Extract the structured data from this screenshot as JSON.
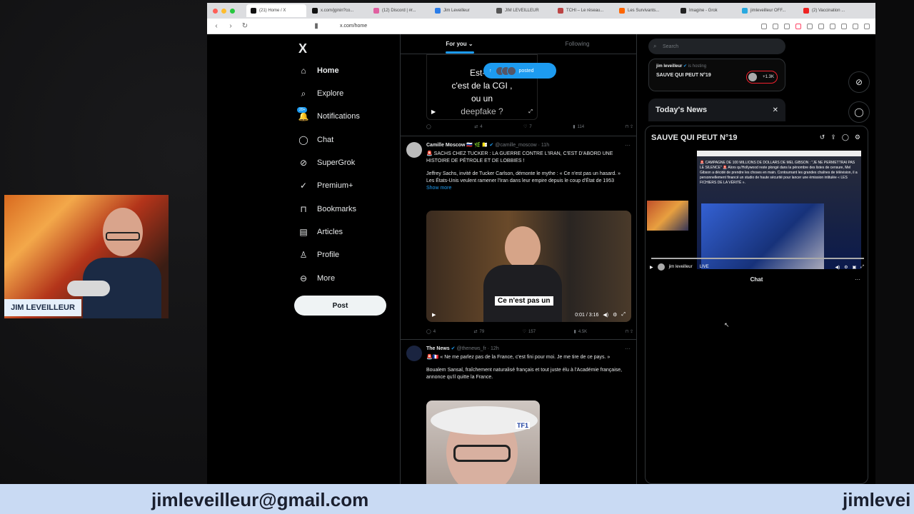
{
  "browser": {
    "tabs": [
      {
        "label": "(21) Home / X",
        "active": true,
        "color": "#111"
      },
      {
        "label": "x.com/jginin?co...",
        "active": false,
        "color": "#111"
      },
      {
        "label": "(12) Discord | #r...",
        "active": false,
        "color": "#e05fa0"
      },
      {
        "label": "Jim Leveilleur",
        "active": false,
        "color": "#2b7de9"
      },
      {
        "label": "JIM LEVEILLEUR",
        "active": false,
        "color": "#555"
      },
      {
        "label": "TCHI – Le réseau...",
        "active": false,
        "color": "#b44"
      },
      {
        "label": "Les Survivants...",
        "active": false,
        "color": "#f60"
      },
      {
        "label": "Imagine - Grok",
        "active": false,
        "color": "#222"
      },
      {
        "label": "jimleveilleur OFF...",
        "active": false,
        "color": "#29a9e0"
      },
      {
        "label": "(2) Vaccination ...",
        "active": false,
        "color": "#e22"
      }
    ],
    "url": "x.com/home"
  },
  "nav": {
    "logo": "X",
    "items": [
      {
        "label": "Home",
        "icon": "home-icon",
        "glyph": "⌂",
        "bold": true
      },
      {
        "label": "Explore",
        "icon": "search-icon",
        "glyph": "⌕"
      },
      {
        "label": "Notifications",
        "icon": "bell-icon",
        "glyph": "🔔",
        "badge": "20+"
      },
      {
        "label": "Chat",
        "icon": "chat-icon",
        "glyph": "◯"
      },
      {
        "label": "SuperGrok",
        "icon": "grok-icon",
        "glyph": "⊘"
      },
      {
        "label": "Premium+",
        "icon": "premium-icon",
        "glyph": "✓"
      },
      {
        "label": "Bookmarks",
        "icon": "bookmark-icon",
        "glyph": "⊓"
      },
      {
        "label": "Articles",
        "icon": "articles-icon",
        "glyph": "▤"
      },
      {
        "label": "Profile",
        "icon": "profile-icon",
        "glyph": "♙"
      },
      {
        "label": "More",
        "icon": "more-icon",
        "glyph": "⊖"
      }
    ],
    "post": "Post"
  },
  "feed": {
    "tabs": [
      "For you",
      "Following"
    ],
    "video_text": [
      "Est-ce",
      "c'est de la CGI ,",
      "ou un",
      "deepfake ?"
    ],
    "posted_pill": "posted",
    "tweet1_actions": {
      "replies": "",
      "reposts": "4",
      "likes": "7",
      "views": "114"
    },
    "tweet2": {
      "name": "Camille Moscow",
      "flags": "🇷🇺 🌿 🇻🇦",
      "handle": "@camille_moscow · 11h",
      "line1": "🚨 SACHS CHEZ TUCKER : LA GUERRE CONTRE L'IRAN, C'EST D'ABORD UNE HISTOIRE DE PÉTROLE ET DE LOBBIES !",
      "line2": "Jeffrey Sachs, invité de Tucker Carlson, démonte le mythe : « Ce n'est pas un hasard. » Les États-Unis veulent ramener l'Iran dans leur empire depuis le coup d'État de 1953",
      "showmore": "Show more",
      "subtitle": "Ce n'est pas un",
      "time": "0:01 / 3:16",
      "actions": {
        "replies": "4",
        "reposts": "79",
        "likes": "157",
        "views": "4.5K"
      }
    },
    "tweet3": {
      "name": "The News",
      "handle": "@thenews_fr · 12h",
      "line1": "🚨🇫🇷 « Ne me parlez pas de la France, c'est fini pour moi. Je me tire de ce pays. »",
      "line2": "Boualem Sansal, fraîchement naturalisé français et tout juste élu à l'Académie française, annonce qu'il quitte la France.",
      "logo": "TF1"
    }
  },
  "right": {
    "search_placeholder": "Search",
    "host": "jim leveilleur",
    "hosting": "is hosting",
    "space_title": "SAUVE QUI PEUT N°19",
    "count": "+1.3K",
    "todays_news": "Today's News",
    "panel_title": "SAUVE QUI PEUT N°19",
    "thumb_text": "🚨 CAMPAGNE DE 100 MILLIONS DE DOLLARS DE MEL GIBSON : \"JE NE PERMETTRAI PAS LE SILENCE\" 🚨 Alors qu'Hollywood reste plongé dans la pénombre des listes de censure, Mel Gibson a décidé de prendre les choses en main. Contournant les grandes chaînes de télévision, il a personnellement financé un studio de haute sécurité pour lancer une émission intitulée « LES FICHIERS DE LA VÉRITÉ ».",
    "live_user": "jim leveilleur",
    "live": "LIVE",
    "chat": "Chat"
  },
  "overlay": {
    "name": "JIM LEVEILLEUR",
    "email": "jimleveilleur@gmail.com",
    "email_partial": "jimlevei"
  },
  "colors": {
    "accent": "#1d9bf0",
    "banner": "#c9daf3"
  }
}
